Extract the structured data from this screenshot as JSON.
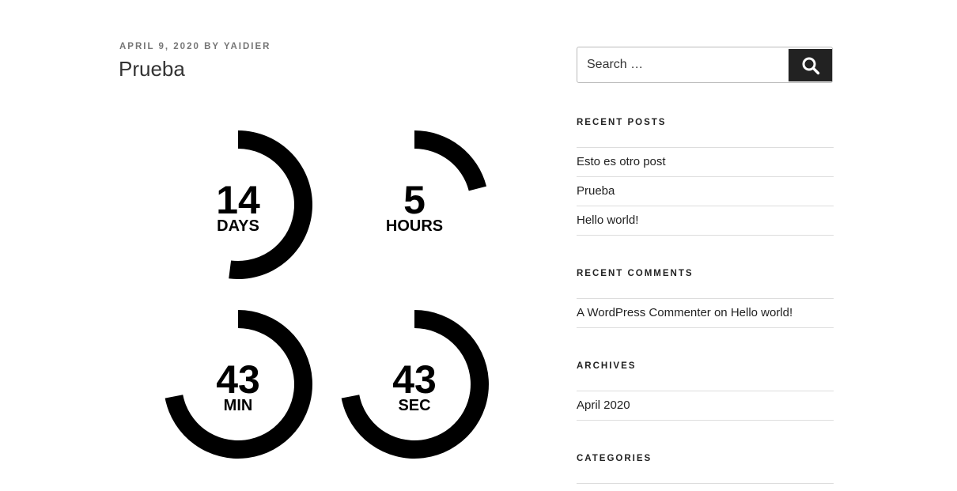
{
  "post": {
    "date": "APRIL 9, 2020",
    "by": "BY",
    "author": "YAIDIER",
    "title": "Prueba"
  },
  "countdown": [
    {
      "id": "days",
      "value": "14",
      "label": "DAYS",
      "fraction": 0.52
    },
    {
      "id": "hours",
      "value": "5",
      "label": "HOURS",
      "fraction": 0.21
    },
    {
      "id": "min",
      "value": "43",
      "label": "MIN",
      "fraction": 0.72
    },
    {
      "id": "sec",
      "value": "43",
      "label": "SEC",
      "fraction": 0.72
    }
  ],
  "sidebar": {
    "search": {
      "placeholder": "Search …",
      "icon": "search-icon"
    },
    "recent_posts": {
      "title": "RECENT POSTS",
      "items": [
        "Esto es otro post",
        "Prueba",
        "Hello world!"
      ]
    },
    "recent_comments": {
      "title": "RECENT COMMENTS",
      "author": "A WordPress Commenter",
      "on": "on",
      "post": "Hello world!"
    },
    "archives": {
      "title": "ARCHIVES",
      "items": [
        "April 2020"
      ]
    },
    "categories": {
      "title": "CATEGORIES"
    }
  }
}
